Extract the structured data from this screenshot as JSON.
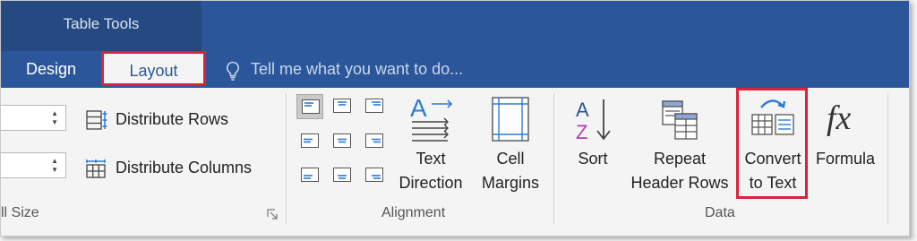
{
  "context_group": {
    "title": "Table Tools"
  },
  "tabs": [
    {
      "label": "Design"
    },
    {
      "label": "Layout",
      "selected": true
    }
  ],
  "tell_me": {
    "placeholder": "Tell me what you want to do..."
  },
  "groups": {
    "cell_size": {
      "label": "ll Size",
      "distribute_rows": "Distribute Rows",
      "distribute_columns": "Distribute Columns"
    },
    "alignment": {
      "label": "Alignment",
      "text_direction": [
        "Text",
        "Direction"
      ],
      "cell_margins": [
        "Cell",
        "Margins"
      ]
    },
    "data": {
      "label": "Data",
      "sort": "Sort",
      "repeat_header_rows": [
        "Repeat",
        "Header Rows"
      ],
      "convert_to_text": [
        "Convert",
        "to Text"
      ],
      "formula": "Formula"
    }
  },
  "colors": {
    "title_bar": "#2b579a",
    "context_group": "#254a82",
    "highlight_border": "#d9233b",
    "sort_a": "#2b579a",
    "sort_z": "#b93ab6"
  },
  "icons": [
    "lightbulb-icon",
    "distribute-rows-icon",
    "distribute-columns-icon",
    "text-direction-icon",
    "cell-margins-icon",
    "sort-icon",
    "repeat-header-rows-icon",
    "convert-to-text-icon",
    "formula-icon",
    "dialog-launcher-icon"
  ]
}
